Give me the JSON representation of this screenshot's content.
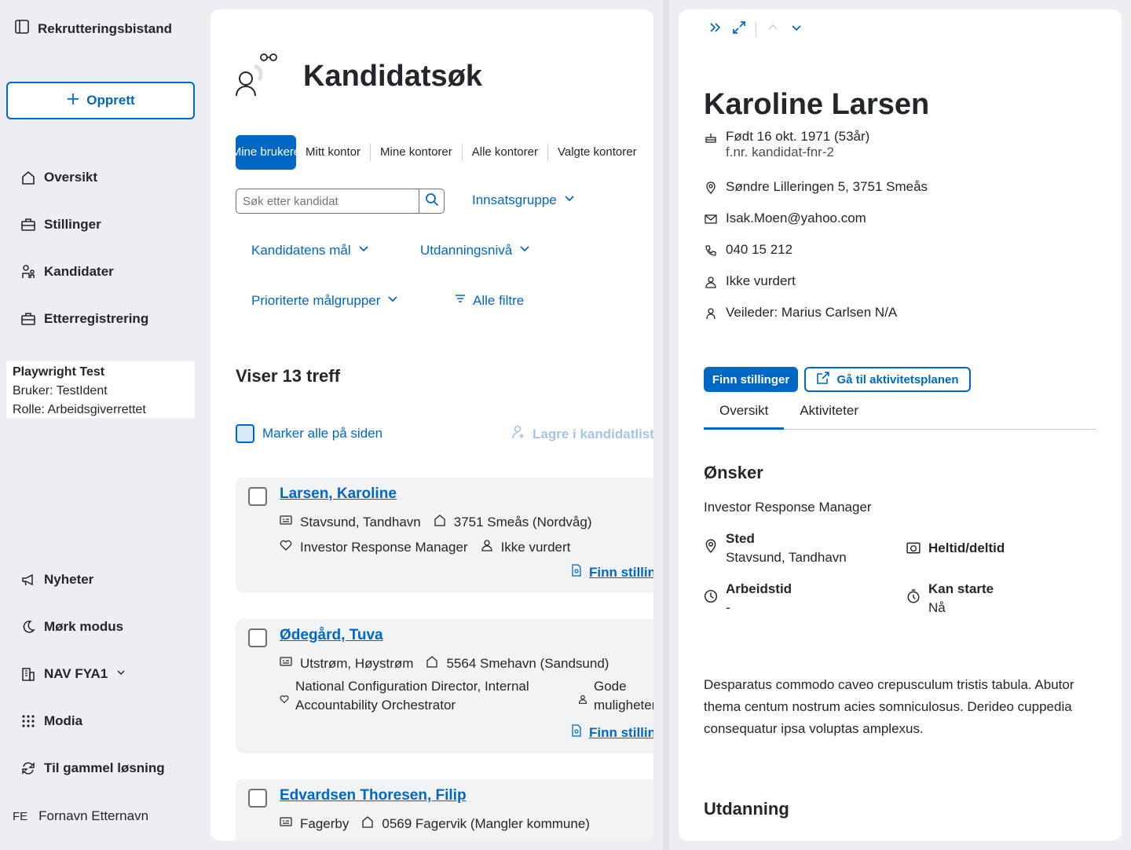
{
  "sidebar": {
    "app_title": "Rekrutteringsbistand",
    "create_label": "Opprett",
    "nav": [
      {
        "label": "Oversikt",
        "icon": "house-icon"
      },
      {
        "label": "Stillinger",
        "icon": "briefcase-icon"
      },
      {
        "label": "Kandidater",
        "icon": "people-icon"
      },
      {
        "label": "Etterregistrering",
        "icon": "briefcase-icon"
      }
    ],
    "test_user": {
      "name": "Playwright Test",
      "user": "Bruker: TestIdent",
      "role": "Rolle: Arbeidsgiverrettet"
    },
    "bottom_nav": [
      {
        "label": "Nyheter",
        "icon": "megaphone-icon"
      },
      {
        "label": "Mørk modus",
        "icon": "moon-icon"
      },
      {
        "label": "NAV FYA1",
        "icon": "buildings-icon"
      },
      {
        "label": "Modia",
        "icon": "grid-icon"
      },
      {
        "label": "Til gammel løsning",
        "icon": "arrows-circle-icon"
      }
    ],
    "user_initials": "FE",
    "user_name": "Fornavn Etternavn"
  },
  "main": {
    "title": "Kandidatsøk",
    "tabs": [
      "Mine brukere",
      "Mitt kontor",
      "Mine kontorer",
      "Alle kontorer",
      "Valgte kontorer"
    ],
    "search_placeholder": "Søk etter kandidat",
    "filters": {
      "innsatsgruppe": "Innsatsgruppe",
      "mal": "Kandidatens mål",
      "utdanning": "Utdanningsnivå",
      "prioriterte": "Prioriterte målgrupper",
      "alle": "Alle filtre"
    },
    "result_count": "Viser 13 treff",
    "mark_all": "Marker alle på siden",
    "save_list": "Lagre i kandidatliste",
    "find_jobs": "Finn stillinger",
    "candidates": [
      {
        "name": "Larsen, Karoline",
        "location": "Stavsund, Tandhavn",
        "home": "3751 Smeås (Nordvåg)",
        "goal": "Investor Response Manager",
        "status": "Ikke vurdert"
      },
      {
        "name": "Ødegård, Tuva",
        "location": "Utstrøm, Høystrøm",
        "home": "5564 Smehavn (Sandsund)",
        "goal_line1": "National Configuration Director, Internal",
        "goal_line2": "Accountability Orchestrator",
        "status_line1": "Gode",
        "status_line2": "muligheter"
      },
      {
        "name": "Edvardsen Thoresen, Filip",
        "location": "Fagerby",
        "home": "0569 Fagervik (Mangler kommune)"
      }
    ]
  },
  "detail": {
    "name": "Karoline Larsen",
    "born": "Født 16 okt. 1971 (53år)",
    "fnr": "f.nr. kandidat-fnr-2",
    "address": "Søndre Lilleringen 5, 3751 Smeås",
    "email": "Isak.Moen@yahoo.com",
    "phone": "040 15 212",
    "assessment": "Ikke vurdert",
    "advisor": "Veileder: Marius Carlsen N/A",
    "btn_find": "Finn stillinger",
    "btn_plan": "Gå til aktivitetsplanen",
    "tabs": [
      "Oversikt",
      "Aktiviteter"
    ],
    "wishes_heading": "Ønsker",
    "wish_job": "Investor Response Manager",
    "facts": {
      "sted_label": "Sted",
      "sted_value": "Stavsund, Tandhavn",
      "heltid_label": "Heltid/deltid",
      "arbeidstid_label": "Arbeidstid",
      "arbeidstid_value": "-",
      "start_label": "Kan starte",
      "start_value": "Nå"
    },
    "summary": "Desparatus commodo caveo crepusculum tristis tabula. Abutor thema centum nostrum acies somniculosus. Derideo cuppedia consequatur ipsa voluptas amplexus.",
    "education_heading": "Utdanning"
  },
  "colors": {
    "accent": "#0067c5",
    "background": "#eceef1",
    "card": "#f2f3f5"
  }
}
